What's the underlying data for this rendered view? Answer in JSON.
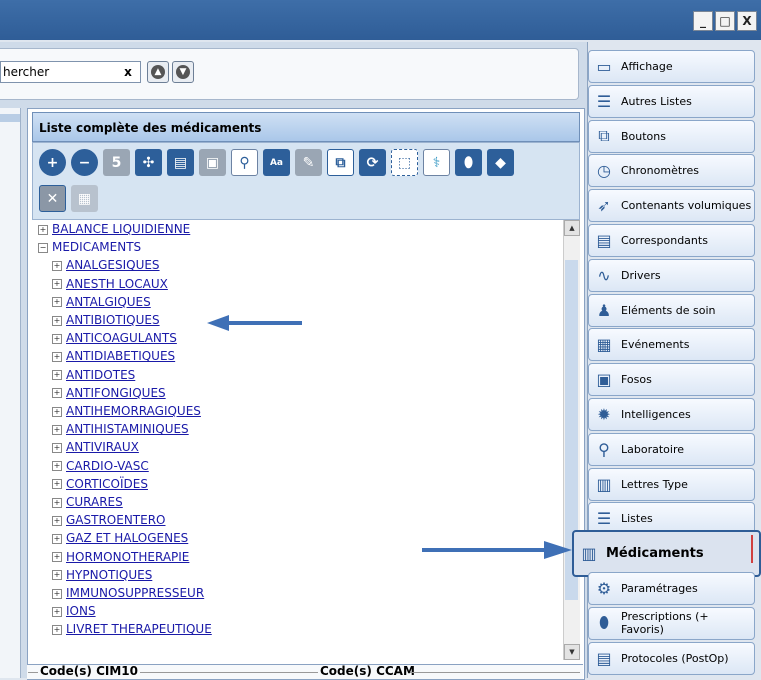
{
  "window": {
    "buttons": [
      "_",
      "□",
      "X"
    ]
  },
  "search": {
    "value": "hercher",
    "clear_label": "x"
  },
  "list": {
    "title": "Liste complète des médicaments",
    "tree": [
      {
        "label": "BALANCE LIQUIDIENNE",
        "level": 0,
        "expanded": false
      },
      {
        "label": "MEDICAMENTS",
        "level": 0,
        "expanded": true
      },
      {
        "label": "ANALGESIQUES",
        "level": 1
      },
      {
        "label": "ANESTH LOCAUX",
        "level": 1
      },
      {
        "label": "ANTALGIQUES",
        "level": 1
      },
      {
        "label": "ANTIBIOTIQUES",
        "level": 1,
        "selected": true
      },
      {
        "label": "ANTICOAGULANTS",
        "level": 1
      },
      {
        "label": "ANTIDIABETIQUES",
        "level": 1
      },
      {
        "label": "ANTIDOTES",
        "level": 1
      },
      {
        "label": "ANTIFONGIQUES",
        "level": 1
      },
      {
        "label": "ANTIHEMORRAGIQUES",
        "level": 1
      },
      {
        "label": "ANTIHISTAMINIQUES",
        "level": 1
      },
      {
        "label": "ANTIVIRAUX",
        "level": 1
      },
      {
        "label": "CARDIO-VASC",
        "level": 1
      },
      {
        "label": "CORTICOÏDES",
        "level": 1
      },
      {
        "label": "CURARES",
        "level": 1
      },
      {
        "label": "GASTROENTERO",
        "level": 1
      },
      {
        "label": "GAZ ET HALOGENES",
        "level": 1
      },
      {
        "label": "HORMONOTHERAPIE",
        "level": 1
      },
      {
        "label": "HYPNOTIQUES",
        "level": 1
      },
      {
        "label": "IMMUNOSUPPRESSEUR",
        "level": 1
      },
      {
        "label": "IONS",
        "level": 1
      },
      {
        "label": "LIVRET THERAPEUTIQUE",
        "level": 1
      }
    ],
    "code_cim10": "Code(s) CIM10",
    "code_ccam": "Code(s) CCAM"
  },
  "menu": [
    {
      "label": "Affichage",
      "icon": "monitor-icon"
    },
    {
      "label": "Autres Listes",
      "icon": "numbered-list-icon"
    },
    {
      "label": "Boutons",
      "icon": "windows-icon"
    },
    {
      "label": "Chronomètres",
      "icon": "clock-icon"
    },
    {
      "label": "Contenants volumiques",
      "icon": "syringe-icon"
    },
    {
      "label": "Correspondants",
      "icon": "contact-card-icon"
    },
    {
      "label": "Drivers",
      "icon": "waveform-icon"
    },
    {
      "label": "Eléments de soin",
      "icon": "person-icon"
    },
    {
      "label": "Evénements",
      "icon": "event-list-icon"
    },
    {
      "label": "Fosos",
      "icon": "form-icon"
    },
    {
      "label": "Intelligences",
      "icon": "gear-star-icon"
    },
    {
      "label": "Laboratoire",
      "icon": "microscope-icon"
    },
    {
      "label": "Lettres Type",
      "icon": "book-icon"
    },
    {
      "label": "Listes",
      "icon": "list-icon"
    },
    {
      "label": "Médicaments",
      "icon": "pills-icon",
      "active": true
    },
    {
      "label": "Paramétrages",
      "icon": "gears-icon"
    },
    {
      "label": "Prescriptions (+ Favoris)",
      "icon": "pill-capsule-icon"
    },
    {
      "label": "Protocoles (PostOp)",
      "icon": "protocol-icon"
    }
  ],
  "colors": {
    "accent": "#2f5d97",
    "titlebar": "#3e6ea8",
    "link": "#1a1aa8"
  }
}
